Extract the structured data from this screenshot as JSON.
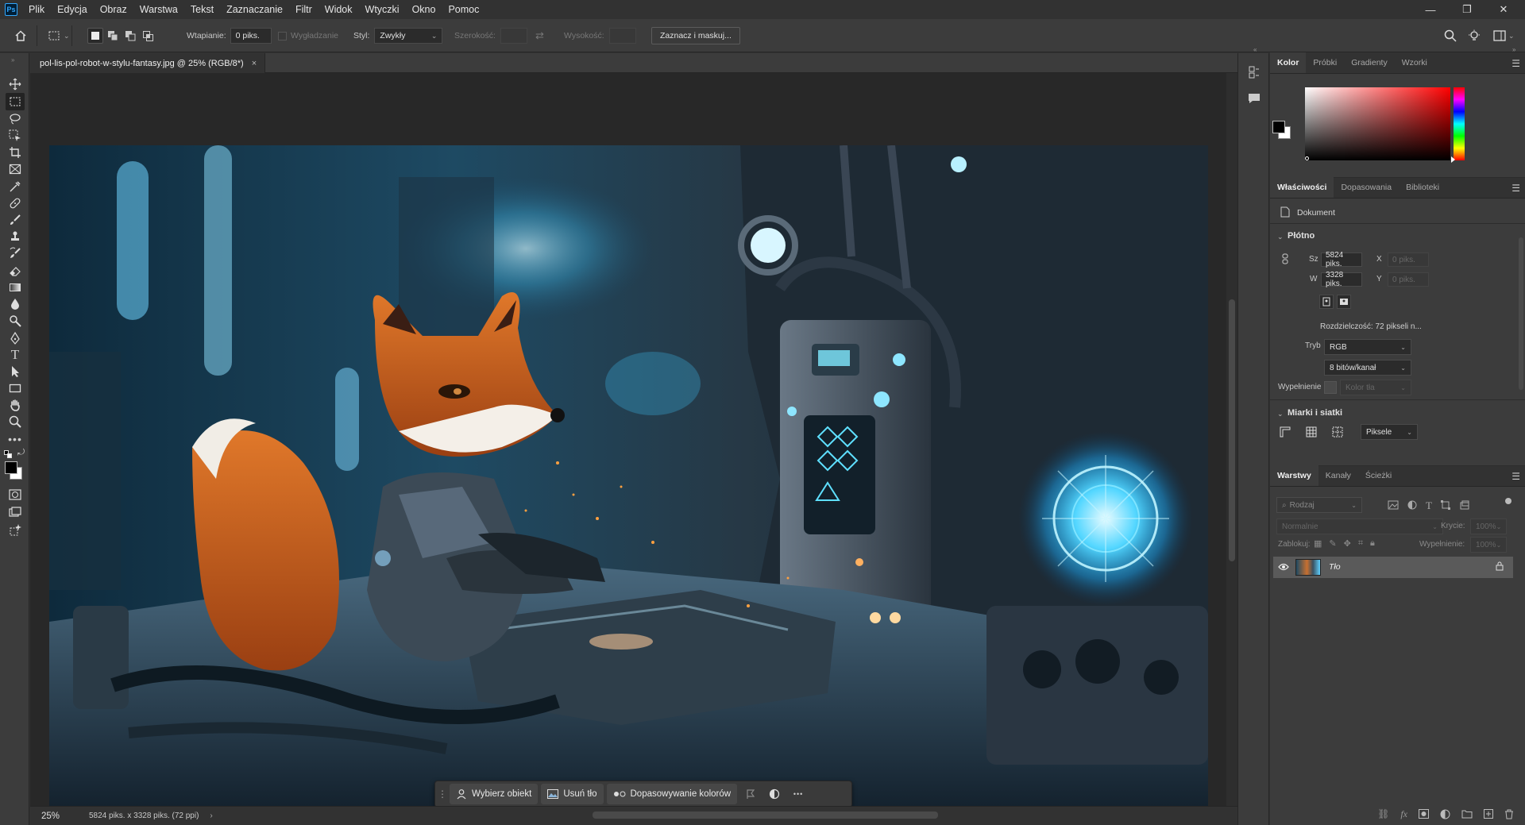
{
  "app": {
    "logo": "Ps"
  },
  "menubar": {
    "items": [
      "Plik",
      "Edycja",
      "Obraz",
      "Warstwa",
      "Tekst",
      "Zaznaczanie",
      "Filtr",
      "Widok",
      "Wtyczki",
      "Okno",
      "Pomoc"
    ]
  },
  "window_controls": {
    "minimize": "—",
    "restore": "❐",
    "close": "✕"
  },
  "options": {
    "feather_label": "Wtapianie:",
    "feather_value": "0 piks.",
    "antialias_label": "Wygładzanie",
    "style_label": "Styl:",
    "style_value": "Zwykły",
    "width_label": "Szerokość:",
    "height_label": "Wysokość:",
    "select_mask_button": "Zaznacz i maskuj..."
  },
  "document": {
    "tab_title": "pol-lis-pol-robot-w-stylu-fantasy.jpg @ 25% (RGB/8*)",
    "close": "×"
  },
  "context_bar": {
    "select_subject": "Wybierz obiekt",
    "remove_bg": "Usuń tło",
    "color_match": "Dopasowywanie kolorów",
    "more": "•••"
  },
  "status": {
    "zoom": "25%",
    "info": "5824 piks. x 3328 piks. (72 ppi)",
    "arrow": "›"
  },
  "panels": {
    "color_tabs": [
      "Kolor",
      "Próbki",
      "Gradienty",
      "Wzorki"
    ],
    "props_tabs": [
      "Właściwości",
      "Dopasowania",
      "Biblioteki"
    ],
    "layers_tabs": [
      "Warstwy",
      "Kanały",
      "Ścieżki"
    ]
  },
  "properties": {
    "doc_label": "Dokument",
    "canvas_section": "Płótno",
    "w_label": "Sz",
    "w_value": "5824 piks.",
    "h_label": "W",
    "h_value": "3328 piks.",
    "x_label": "X",
    "x_value": "0 piks.",
    "y_label": "Y",
    "y_value": "0 piks.",
    "resolution": "Rozdzielczość: 72 pikseli n...",
    "mode_label": "Tryb",
    "mode_value": "RGB",
    "depth_value": "8 bitów/kanał",
    "fill_label": "Wypełnienie",
    "fill_value": "Kolor tła",
    "rulers_section": "Miarki i siatki",
    "units_value": "Piksele"
  },
  "layers": {
    "filter_placeholder": "Rodzaj",
    "blend_mode": "Normalnie",
    "opacity_label": "Krycie:",
    "opacity_value": "100%",
    "lock_label": "Zablokuj:",
    "fill_label": "Wypełnienie:",
    "fill_value": "100%",
    "layer_name": "Tło"
  },
  "colors": {
    "accent": "#31a8ff",
    "foreground": "#000000",
    "background": "#ffffff"
  }
}
